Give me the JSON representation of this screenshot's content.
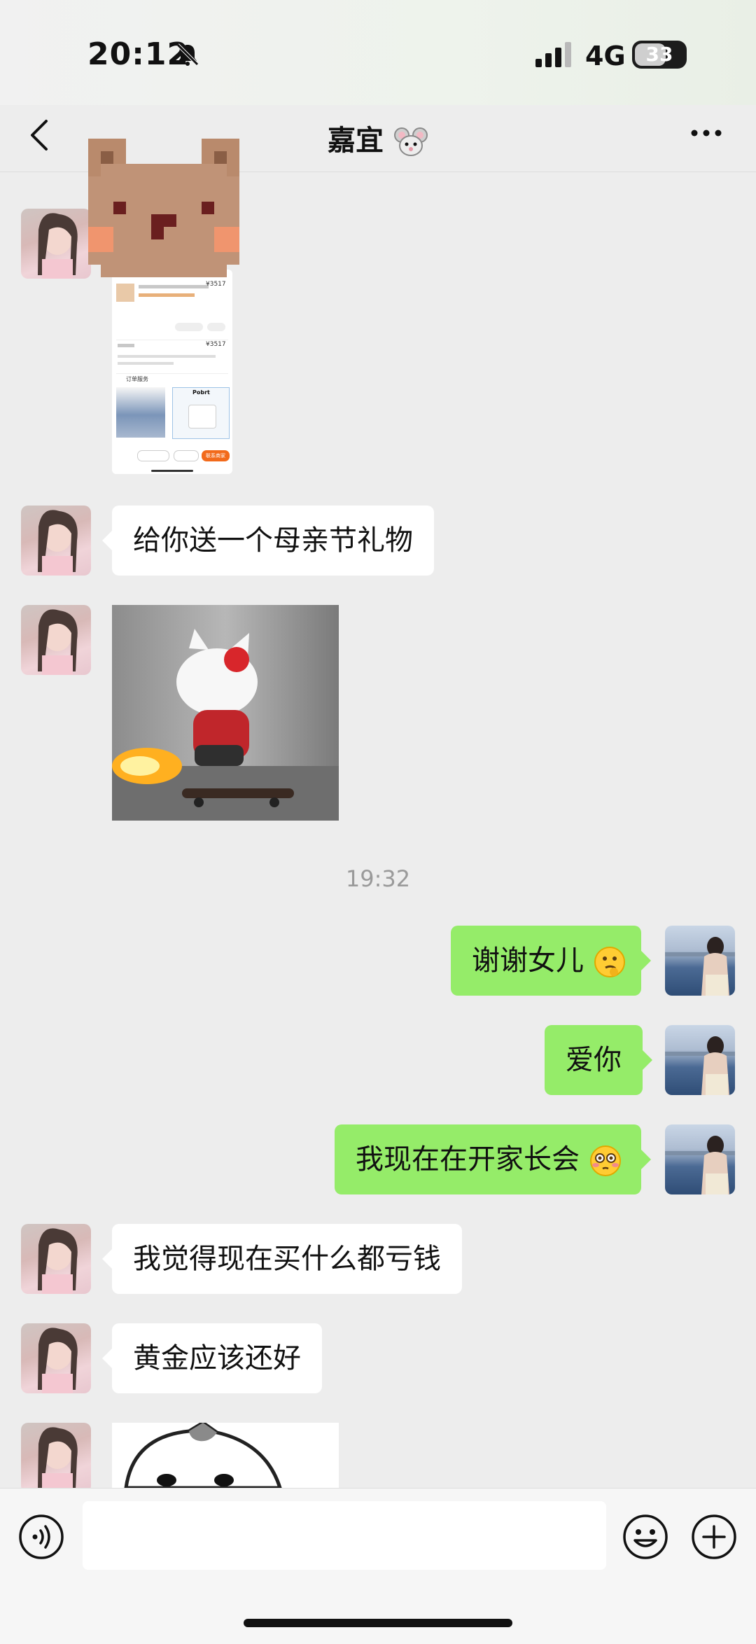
{
  "status_bar": {
    "time": "20:12",
    "network": "4G",
    "battery": "33"
  },
  "header": {
    "title": "嘉宜"
  },
  "messages": [
    {
      "text": "给你送一个母亲节礼物"
    },
    {
      "text": "谢谢女儿"
    },
    {
      "text": "爱你"
    },
    {
      "text": "我现在在开家长会"
    },
    {
      "text": "我觉得现在买什么都亏钱"
    },
    {
      "text": "黄金应该还好"
    }
  ],
  "order_card": {
    "price_1": "¥3517",
    "price_2": "¥3517",
    "section_label": "订单服务",
    "product_label": "Pobrt",
    "button_label": "联系商家"
  },
  "timestamp": "19:32",
  "colors": {
    "accent_green": "#95ec69",
    "background": "#ededed",
    "bubble_white": "#ffffff"
  },
  "icons": [
    "back-arrow-icon",
    "mute-bell-icon",
    "signal-icon",
    "battery-icon",
    "more-icon",
    "mouse-emoji-icon",
    "voice-icon",
    "emoji-icon",
    "plus-icon",
    "thinking-emoji-icon",
    "flushed-emoji-icon"
  ]
}
